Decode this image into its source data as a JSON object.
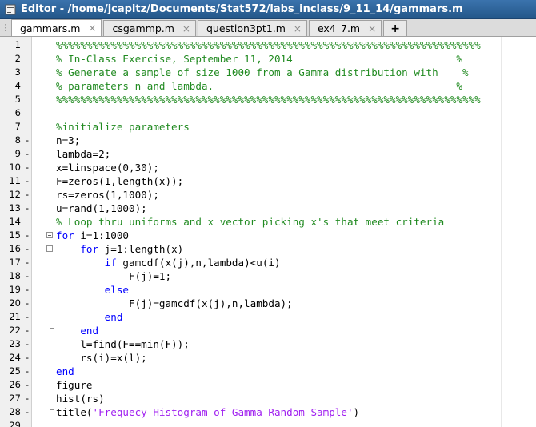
{
  "window": {
    "title": "Editor - /home/jcapitz/Documents/Stat572/labs_inclass/9_11_14/gammars.m"
  },
  "tabs": [
    {
      "label": "gammars.m",
      "active": true
    },
    {
      "label": "csgammp.m",
      "active": false
    },
    {
      "label": "question3pt1.m",
      "active": false
    },
    {
      "label": "ex4_7.m",
      "active": false
    }
  ],
  "add_tab_label": "+",
  "close_glyph": "×",
  "colors": {
    "comment": "#228b22",
    "keyword": "#0000ff",
    "string": "#a020f0"
  },
  "lines": [
    {
      "n": "1",
      "dash": "",
      "tokens": [
        {
          "t": "%%%%%%%%%%%%%%%%%%%%%%%%%%%%%%%%%%%%%%%%%%%%%%%%%%%%%%%%%%%%%%%%%%%%%%",
          "c": "comment"
        }
      ]
    },
    {
      "n": "2",
      "dash": "",
      "tokens": [
        {
          "t": "% In-Class Exercise, September 11, 2014                           %",
          "c": "comment"
        }
      ]
    },
    {
      "n": "3",
      "dash": "",
      "tokens": [
        {
          "t": "% Generate a sample of size 1000 from a Gamma distribution with    %",
          "c": "comment"
        }
      ]
    },
    {
      "n": "4",
      "dash": "",
      "tokens": [
        {
          "t": "% parameters n and lambda.                                        %",
          "c": "comment"
        }
      ]
    },
    {
      "n": "5",
      "dash": "",
      "tokens": [
        {
          "t": "%%%%%%%%%%%%%%%%%%%%%%%%%%%%%%%%%%%%%%%%%%%%%%%%%%%%%%%%%%%%%%%%%%%%%%",
          "c": "comment"
        }
      ]
    },
    {
      "n": "6",
      "dash": "",
      "tokens": []
    },
    {
      "n": "7",
      "dash": "",
      "tokens": [
        {
          "t": "%initialize parameters",
          "c": "comment"
        }
      ]
    },
    {
      "n": "8",
      "dash": "-",
      "tokens": [
        {
          "t": "n=3;",
          "c": "plain"
        }
      ]
    },
    {
      "n": "9",
      "dash": "-",
      "tokens": [
        {
          "t": "lambda=2;",
          "c": "plain"
        }
      ]
    },
    {
      "n": "10",
      "dash": "-",
      "tokens": [
        {
          "t": "x=linspace(0,30);",
          "c": "plain"
        }
      ]
    },
    {
      "n": "11",
      "dash": "-",
      "tokens": [
        {
          "t": "F=zeros(1,length(x));",
          "c": "plain"
        }
      ]
    },
    {
      "n": "12",
      "dash": "-",
      "tokens": [
        {
          "t": "rs=zeros(1,1000);",
          "c": "plain"
        }
      ]
    },
    {
      "n": "13",
      "dash": "-",
      "tokens": [
        {
          "t": "u=rand(1,1000);",
          "c": "plain"
        }
      ]
    },
    {
      "n": "14",
      "dash": "",
      "tokens": [
        {
          "t": "% Loop thru uniforms and x vector picking x's that meet criteria",
          "c": "comment"
        }
      ]
    },
    {
      "n": "15",
      "dash": "-",
      "fold": true,
      "tokens": [
        {
          "t": "for",
          "c": "keyword"
        },
        {
          "t": " i=1:1000",
          "c": "plain"
        }
      ]
    },
    {
      "n": "16",
      "dash": "-",
      "fold": true,
      "tokens": [
        {
          "t": "    ",
          "c": "plain"
        },
        {
          "t": "for",
          "c": "keyword"
        },
        {
          "t": " j=1:length(x)",
          "c": "plain"
        }
      ]
    },
    {
      "n": "17",
      "dash": "-",
      "tokens": [
        {
          "t": "        ",
          "c": "plain"
        },
        {
          "t": "if",
          "c": "keyword"
        },
        {
          "t": " gamcdf(x(j),n,lambda)<u(i)",
          "c": "plain"
        }
      ]
    },
    {
      "n": "18",
      "dash": "-",
      "tokens": [
        {
          "t": "            F(j)=1;",
          "c": "plain"
        }
      ]
    },
    {
      "n": "19",
      "dash": "-",
      "tokens": [
        {
          "t": "        ",
          "c": "plain"
        },
        {
          "t": "else",
          "c": "keyword"
        }
      ]
    },
    {
      "n": "20",
      "dash": "-",
      "tokens": [
        {
          "t": "            F(j)=gamcdf(x(j),n,lambda);",
          "c": "plain"
        }
      ]
    },
    {
      "n": "21",
      "dash": "-",
      "tokens": [
        {
          "t": "        ",
          "c": "plain"
        },
        {
          "t": "end",
          "c": "keyword"
        }
      ]
    },
    {
      "n": "22",
      "dash": "-",
      "tokens": [
        {
          "t": "    ",
          "c": "plain"
        },
        {
          "t": "end",
          "c": "keyword"
        }
      ]
    },
    {
      "n": "23",
      "dash": "-",
      "tokens": [
        {
          "t": "    l=find(F==min(F));",
          "c": "plain"
        }
      ]
    },
    {
      "n": "24",
      "dash": "-",
      "tokens": [
        {
          "t": "    rs(i)=x(l);",
          "c": "plain"
        }
      ]
    },
    {
      "n": "25",
      "dash": "-",
      "tokens": [
        {
          "t": "end",
          "c": "keyword"
        }
      ]
    },
    {
      "n": "26",
      "dash": "-",
      "tokens": [
        {
          "t": "figure",
          "c": "plain"
        }
      ]
    },
    {
      "n": "27",
      "dash": "-",
      "tokens": [
        {
          "t": "hist(rs)",
          "c": "plain"
        }
      ]
    },
    {
      "n": "28",
      "dash": "-",
      "tokens": [
        {
          "t": "title(",
          "c": "plain"
        },
        {
          "t": "'Frequecy Histogram of Gamma Random Sample'",
          "c": "string"
        },
        {
          "t": ")",
          "c": "plain"
        }
      ]
    },
    {
      "n": "29",
      "dash": "",
      "tokens": []
    }
  ]
}
